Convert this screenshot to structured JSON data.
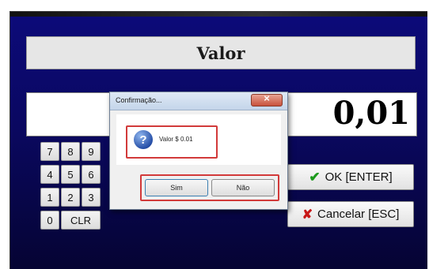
{
  "screen": {
    "label": "Valor",
    "value": "0,01"
  },
  "keypad": {
    "keys": [
      "7",
      "8",
      "9",
      "4",
      "5",
      "6",
      "1",
      "2",
      "3",
      "0",
      "CLR"
    ]
  },
  "actions": {
    "ok_label": "OK [ENTER]",
    "ok_icon": "checkmark-icon",
    "cancel_label": "Cancelar [ESC]",
    "cancel_icon": "x-icon"
  },
  "dialog": {
    "title": "Confirmação...",
    "icon": "question-icon",
    "message": "Valor $ 0.01",
    "buttons": {
      "yes": "Sim",
      "no": "Não"
    }
  },
  "colors": {
    "background": "#0a0860",
    "highlight": "#d23a3a",
    "ok_check": "#1c9a1c",
    "cancel_x": "#c81818"
  }
}
